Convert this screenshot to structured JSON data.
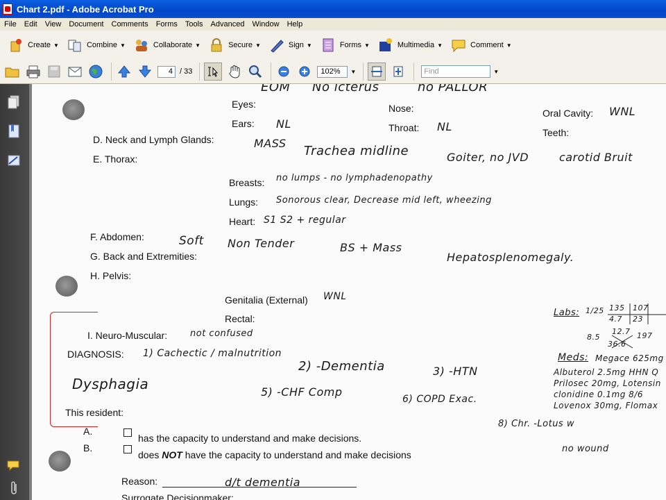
{
  "window": {
    "title": "Chart 2.pdf - Adobe Acrobat Pro"
  },
  "menu": [
    "File",
    "Edit",
    "View",
    "Document",
    "Comments",
    "Forms",
    "Tools",
    "Advanced",
    "Window",
    "Help"
  ],
  "toolbar": {
    "create": "Create",
    "combine": "Combine",
    "collaborate": "Collaborate",
    "secure": "Secure",
    "sign": "Sign",
    "forms": "Forms",
    "multimedia": "Multimedia",
    "comment": "Comment"
  },
  "nav": {
    "page_current": "4",
    "page_total": "/ 33",
    "zoom": "102%",
    "find_placeholder": "Find"
  },
  "document": {
    "top_hw_1": "EOM",
    "top_hw_2": "No icterus",
    "top_hw_3": "no PALLOR",
    "eyes": "Eyes:",
    "nose": "Nose:",
    "oral_cavity": "Oral Cavity:",
    "oral_hw": "WNL",
    "ears": "Ears:",
    "ears_hw": "NL",
    "throat": "Throat:",
    "throat_hw": "NL",
    "teeth": "Teeth:",
    "neck": "D.  Neck and Lymph Glands:",
    "neck_hw_1": "MASS",
    "neck_hw_2": "Trachea midline",
    "neck_hw_3": "Goiter, no JVD",
    "neck_hw_4": "carotid Bruit",
    "thorax": "E.  Thorax:",
    "breasts": "Breasts:",
    "breasts_hw": "no lumps - no lymphadenopathy",
    "lungs": "Lungs:",
    "lungs_hw": "Sonorous clear, Decrease mid left, wheezing",
    "heart": "Heart:",
    "heart_hw": "S1 S2 +  regular",
    "abdomen": "F.  Abdomen:",
    "abd_hw_1": "Soft",
    "abd_hw_2": "Non Tender",
    "abd_hw_3": "BS + Mass",
    "abd_hw_4": "Hepatosplenomegaly.",
    "back": "G.  Back and Extremities:",
    "pelvis": "H.  Pelvis:",
    "genitalia": "Genitalia  (External)",
    "genitalia_hw": "WNL",
    "rectal": "Rectal:",
    "neuro": "I.  Neuro-Muscular:",
    "neuro_hw": "not confused",
    "diagnosis": "DIAGNOSIS:",
    "dx_1": "1) Cachectic / malnutrition",
    "dx_2": "2) -Dementia",
    "dx_3": "3) -HTN",
    "dx_4": "Dysphagia",
    "dx_5": "5) -CHF Comp",
    "dx_6": "6) COPD Exac.",
    "dx_7": "8) Chr. -Lotus w",
    "dx_8": "no wound",
    "resident": "This resident:",
    "a": "A.",
    "a_text": "has the capacity to understand and make decisions.",
    "b": "B.",
    "b_text_1": "does",
    "b_text_not": "NOT",
    "b_text_2": "have the capacity to understand and make decisions",
    "reason": "Reason:",
    "reason_hw": "d/t  dementia",
    "surrogate": "Surrogate Decisionmaker:",
    "labs_title": "Labs:",
    "labs_date": "1/25",
    "labs_vals": [
      "135",
      "107",
      "4.7",
      "23",
      "8.5",
      "12.7",
      "197",
      "36.6"
    ],
    "meds_title": "Meds:",
    "meds": [
      "Megace 625mg",
      "Albuterol 2.5mg HHN Q",
      "Prilosec 20mg, Lotensin",
      "clonidine 0.1mg 8/6",
      "Lovenox 30mg, Flomax"
    ]
  }
}
